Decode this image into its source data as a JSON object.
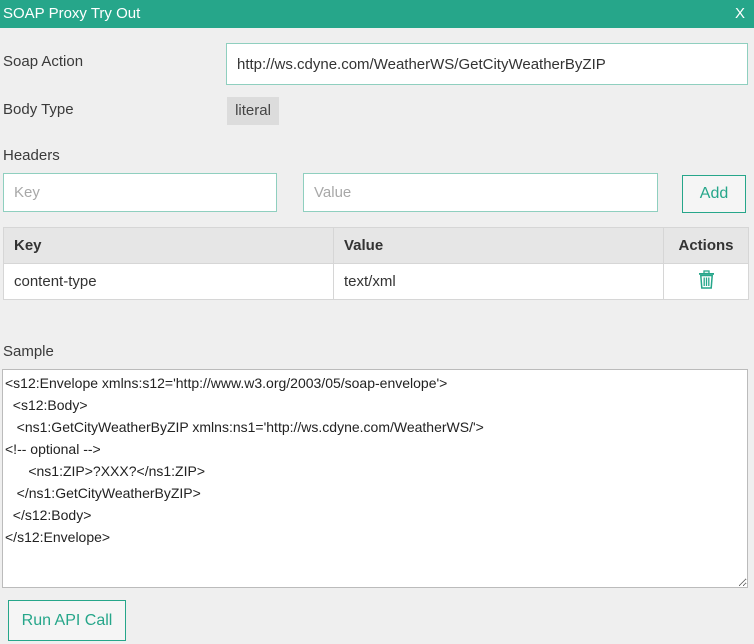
{
  "title": "SOAP Proxy Try Out",
  "close_label": "X",
  "soap_action": {
    "label": "Soap Action",
    "value": "http://ws.cdyne.com/WeatherWS/GetCityWeatherByZIP"
  },
  "body_type": {
    "label": "Body Type",
    "value": "literal"
  },
  "headers": {
    "label": "Headers",
    "key_placeholder": "Key",
    "value_placeholder": "Value",
    "add_label": "Add",
    "columns": [
      "Key",
      "Value",
      "Actions"
    ],
    "rows": [
      {
        "key": "content-type",
        "value": "text/xml",
        "action_icon": "trash-icon"
      }
    ]
  },
  "sample": {
    "label": "Sample",
    "text": "<s12:Envelope xmlns:s12='http://www.w3.org/2003/05/soap-envelope'>\n  <s12:Body>\n   <ns1:GetCityWeatherByZIP xmlns:ns1='http://ws.cdyne.com/WeatherWS/'>\n<!-- optional -->\n      <ns1:ZIP>?XXX?</ns1:ZIP>\n   </ns1:GetCityWeatherByZIP>\n  </s12:Body>\n</s12:Envelope>"
  },
  "run_label": "Run API Call",
  "colors": {
    "accent": "#26a68a",
    "background": "#efefef"
  }
}
